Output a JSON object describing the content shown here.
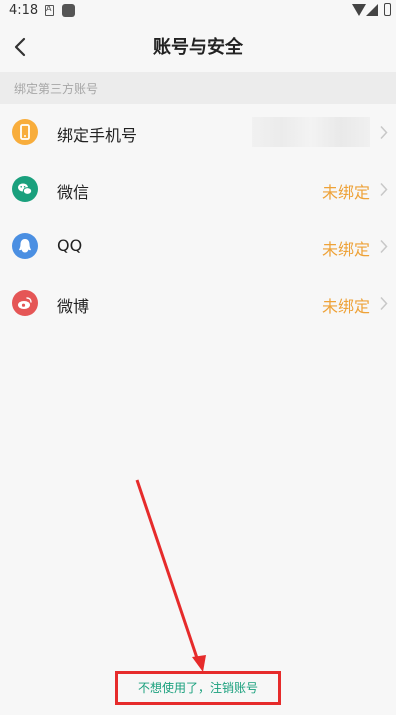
{
  "status_bar": {
    "time": "4:18"
  },
  "header": {
    "title": "账号与安全",
    "back_icon": "chevron-left-icon"
  },
  "section": {
    "label": "绑定第三方账号"
  },
  "accounts": [
    {
      "key": "phone",
      "label": "绑定手机号",
      "value": "",
      "icon": "phone-icon",
      "color": "#f8ad3c"
    },
    {
      "key": "wechat",
      "label": "微信",
      "value": "未绑定",
      "icon": "wechat-icon",
      "color": "#1aa07d"
    },
    {
      "key": "qq",
      "label": "QQ",
      "value": "未绑定",
      "icon": "qq-icon",
      "color": "#4b8fe2"
    },
    {
      "key": "weibo",
      "label": "微博",
      "value": "未绑定",
      "icon": "weibo-icon",
      "color": "#e55656"
    }
  ],
  "footer": {
    "deregister_label": "不想使用了，注销账号"
  },
  "colors": {
    "accent_orange": "#eea238",
    "link_green": "#1aa07d",
    "annotation_red": "#e62b2b"
  }
}
